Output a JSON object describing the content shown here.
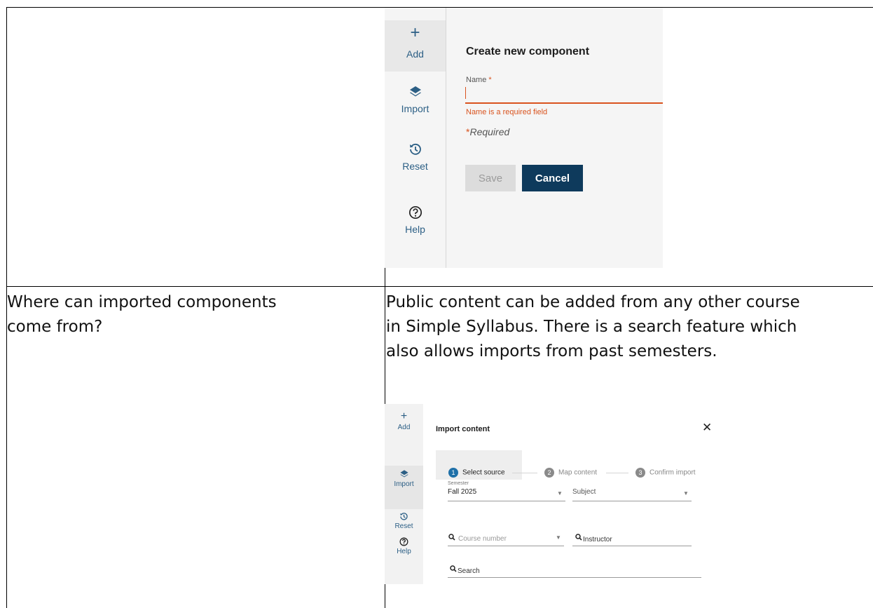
{
  "row2": {
    "question": [
      "Where can imported components",
      "come from?"
    ],
    "answer": [
      "Public content can be added from any other course",
      "in Simple Syllabus. There is a search feature which",
      "also allows imports from past semesters."
    ]
  },
  "screenshot1": {
    "rail": {
      "add": "Add",
      "import": "Import",
      "reset": "Reset",
      "help": "Help"
    },
    "title": "Create new component",
    "name_label": "Name",
    "required_star": "*",
    "error": "Name is a required field",
    "required_note": "Required",
    "save": "Save",
    "cancel": "Cancel"
  },
  "screenshot2": {
    "rail": {
      "add": "Add",
      "import": "Import",
      "reset": "Reset",
      "help": "Help"
    },
    "title": "Import content",
    "steps": [
      {
        "num": "1",
        "label": "Select source"
      },
      {
        "num": "2",
        "label": "Map content"
      },
      {
        "num": "3",
        "label": "Confirm import"
      }
    ],
    "semester_label": "Semester",
    "semester_value": "Fall 2025",
    "subject_placeholder": "Subject",
    "course_placeholder": "Course number",
    "instructor_placeholder": "Instructor",
    "search_placeholder": "Search"
  },
  "colors": {
    "accent": "#2c5f85",
    "error": "#d9531e",
    "primary_button": "#0e3a5c",
    "step_active": "#1f70a8"
  }
}
